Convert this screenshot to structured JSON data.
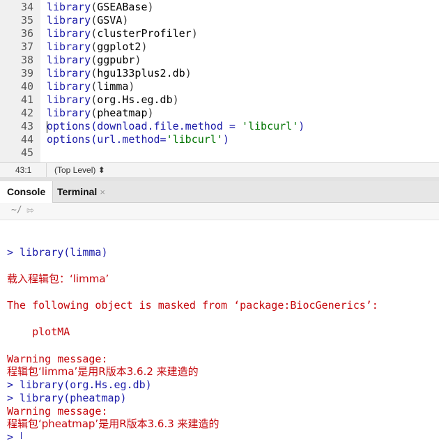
{
  "editor": {
    "lines": [
      {
        "num": "34",
        "fn": "library",
        "arg": "GSEABase"
      },
      {
        "num": "35",
        "fn": "library",
        "arg": "GSVA"
      },
      {
        "num": "36",
        "fn": "library",
        "arg": "clusterProfiler"
      },
      {
        "num": "37",
        "fn": "library",
        "arg": "ggplot2"
      },
      {
        "num": "38",
        "fn": "library",
        "arg": "ggpubr"
      },
      {
        "num": "39",
        "fn": "library",
        "arg": "hgu133plus2.db"
      },
      {
        "num": "40",
        "fn": "library",
        "arg": "limma"
      },
      {
        "num": "41",
        "fn": "library",
        "arg": "org.Hs.eg.db"
      },
      {
        "num": "42",
        "fn": "library",
        "arg": "pheatmap"
      }
    ],
    "line43": {
      "num": "43",
      "pre": "options(download.file.method = ",
      "str": "'libcurl'",
      "post": ")"
    },
    "line44": {
      "num": "44",
      "pre": "options(url.method=",
      "str": "'libcurl'",
      "post": ")"
    },
    "line45": {
      "num": "45"
    }
  },
  "status": {
    "position": "43:1",
    "scope": "(Top Level) ⬍"
  },
  "tabs": {
    "console": "Console",
    "terminal": "Terminal",
    "close": "×"
  },
  "console_toolbar": {
    "wd": "~/",
    "arrow": "⇰"
  },
  "console": {
    "l1": "> library(limma)",
    "l2": "载入程辑包：‘limma’",
    "l3": "The following object is masked from ‘package:BiocGenerics’:",
    "l4": "    plotMA",
    "l5": "Warning message:",
    "l6": "程辑包‘limma’是用R版本3.6.2 来建造的",
    "l7": "> library(org.Hs.eg.db)",
    "l8": "> library(pheatmap)",
    "l9": "Warning message:",
    "l10": "程辑包‘pheatmap’是用R版本3.6.3 来建造的",
    "prompt": ">"
  }
}
